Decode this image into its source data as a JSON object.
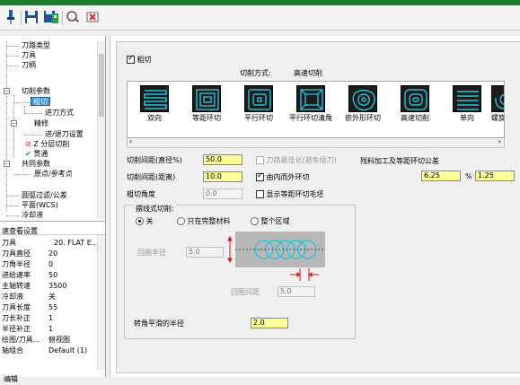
{
  "toolbar": {
    "icons": [
      "pin-icon",
      "save-icon",
      "save-all-icon",
      "edit-icon",
      "delete-icon"
    ]
  },
  "tree": {
    "items": [
      {
        "label": "刀路类型"
      },
      {
        "label": "刀具"
      },
      {
        "label": "刀柄"
      },
      {
        "label": "切削参数"
      },
      {
        "label": "粗切"
      },
      {
        "label": "进刀方式"
      },
      {
        "label": "精修"
      },
      {
        "label": "进/退刀设置"
      },
      {
        "label": "Z 分层切削"
      },
      {
        "label": "贯通"
      },
      {
        "label": "共同参数"
      },
      {
        "label": "原点/参考点"
      },
      {
        "label": "圆弧过滤/公差"
      },
      {
        "label": "平面(WCS)"
      },
      {
        "label": "冷却液"
      }
    ]
  },
  "quick_view": {
    "title": "速查看设置",
    "rows": [
      {
        "k": "刀具",
        "v": "20. FLAT E..."
      },
      {
        "k": "刀具直径",
        "v": "20"
      },
      {
        "k": "刀角半径",
        "v": "0"
      },
      {
        "k": "进给速率",
        "v": "50"
      },
      {
        "k": "主轴转速",
        "v": "3500"
      },
      {
        "k": "冷却液",
        "v": "关"
      },
      {
        "k": "刀具长度",
        "v": "55"
      },
      {
        "k": "刀长补正",
        "v": "1"
      },
      {
        "k": "半径补正",
        "v": "1"
      },
      {
        "k": "绘图/刀具...",
        "v": "俯视图"
      },
      {
        "k": "轴组合",
        "v": "Default (1)"
      }
    ]
  },
  "rough": {
    "checkbox_label": "粗切",
    "checked": true,
    "cut_method_label": "切削方式:",
    "cut_method_value": "高速切削",
    "methods": [
      {
        "label": "双向"
      },
      {
        "label": "等距环切"
      },
      {
        "label": "平行环切"
      },
      {
        "label": "平行环切清角"
      },
      {
        "label": "依外形环切"
      },
      {
        "label": "高速切削"
      },
      {
        "label": "单向"
      },
      {
        "label": "螺旋"
      }
    ],
    "stepover_pct_label": "切削间距(直径%)",
    "stepover_pct_value": "50.0",
    "stepover_dist_label": "切削间距(距离)",
    "stepover_dist_value": "10.0",
    "rough_angle_label": "粗切角度",
    "rough_angle_value": "0.0",
    "optimize_label": "刀路最佳化(避免插刀)",
    "optimize_checked": false,
    "inside_out_label": "由内而外环切",
    "inside_out_checked": true,
    "show_stock_label": "显示等距环切毛坯",
    "show_stock_checked": false,
    "tolerance_label": "残料加工及等距环切公差",
    "tolerance_value1": "6.25",
    "tolerance_unit": "%",
    "tolerance_value2": "1.25"
  },
  "trochoidal": {
    "title": "摆线式切削:",
    "options": [
      "关",
      "只在完整材料",
      "整个区域"
    ],
    "selected": 0,
    "loop_radius_label": "回圈半径",
    "loop_radius_value": "5.0",
    "loop_spacing_label": "回圈间距",
    "loop_spacing_value": "5.0",
    "corner_radius_label": "转角平滑的半径",
    "corner_radius_value": "2.0"
  },
  "colors": {
    "accent_green": "#1d7f2d",
    "highlight": "#ffff99",
    "preview_bg": "#b8b8b8",
    "preview_path": "#16c6e0"
  },
  "status": {
    "text": "编辑"
  }
}
